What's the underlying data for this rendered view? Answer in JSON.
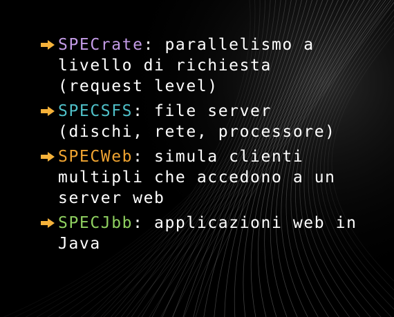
{
  "colors": {
    "background": "#000000",
    "text": "#ffffff",
    "arrow": "#f5b23a",
    "specrate": "#c39be6",
    "specsfs": "#4fc0c9",
    "specweb": "#f0a431",
    "specjbb": "#8fd060"
  },
  "bullets": [
    {
      "icon": "arrow-right-icon",
      "name": "SPECrate",
      "name_color": "#c39be6",
      "first": ": parallelismo a",
      "lines": [
        "livello di richiesta",
        "(request level)"
      ]
    },
    {
      "icon": "arrow-right-icon",
      "name": "SPECSFS",
      "name_color": "#4fc0c9",
      "first": ": file server",
      "lines": [
        "(dischi, rete, processore)"
      ]
    },
    {
      "icon": "arrow-right-icon",
      "name": "SPECWeb",
      "name_color": "#f0a431",
      "first": ": simula clienti",
      "lines": [
        "multipli che accedono a un",
        "server web"
      ]
    },
    {
      "icon": "arrow-right-icon",
      "name": "SPECJbb",
      "name_color": "#8fd060",
      "first": ": applicazioni web in",
      "lines": [
        "Java"
      ]
    }
  ]
}
